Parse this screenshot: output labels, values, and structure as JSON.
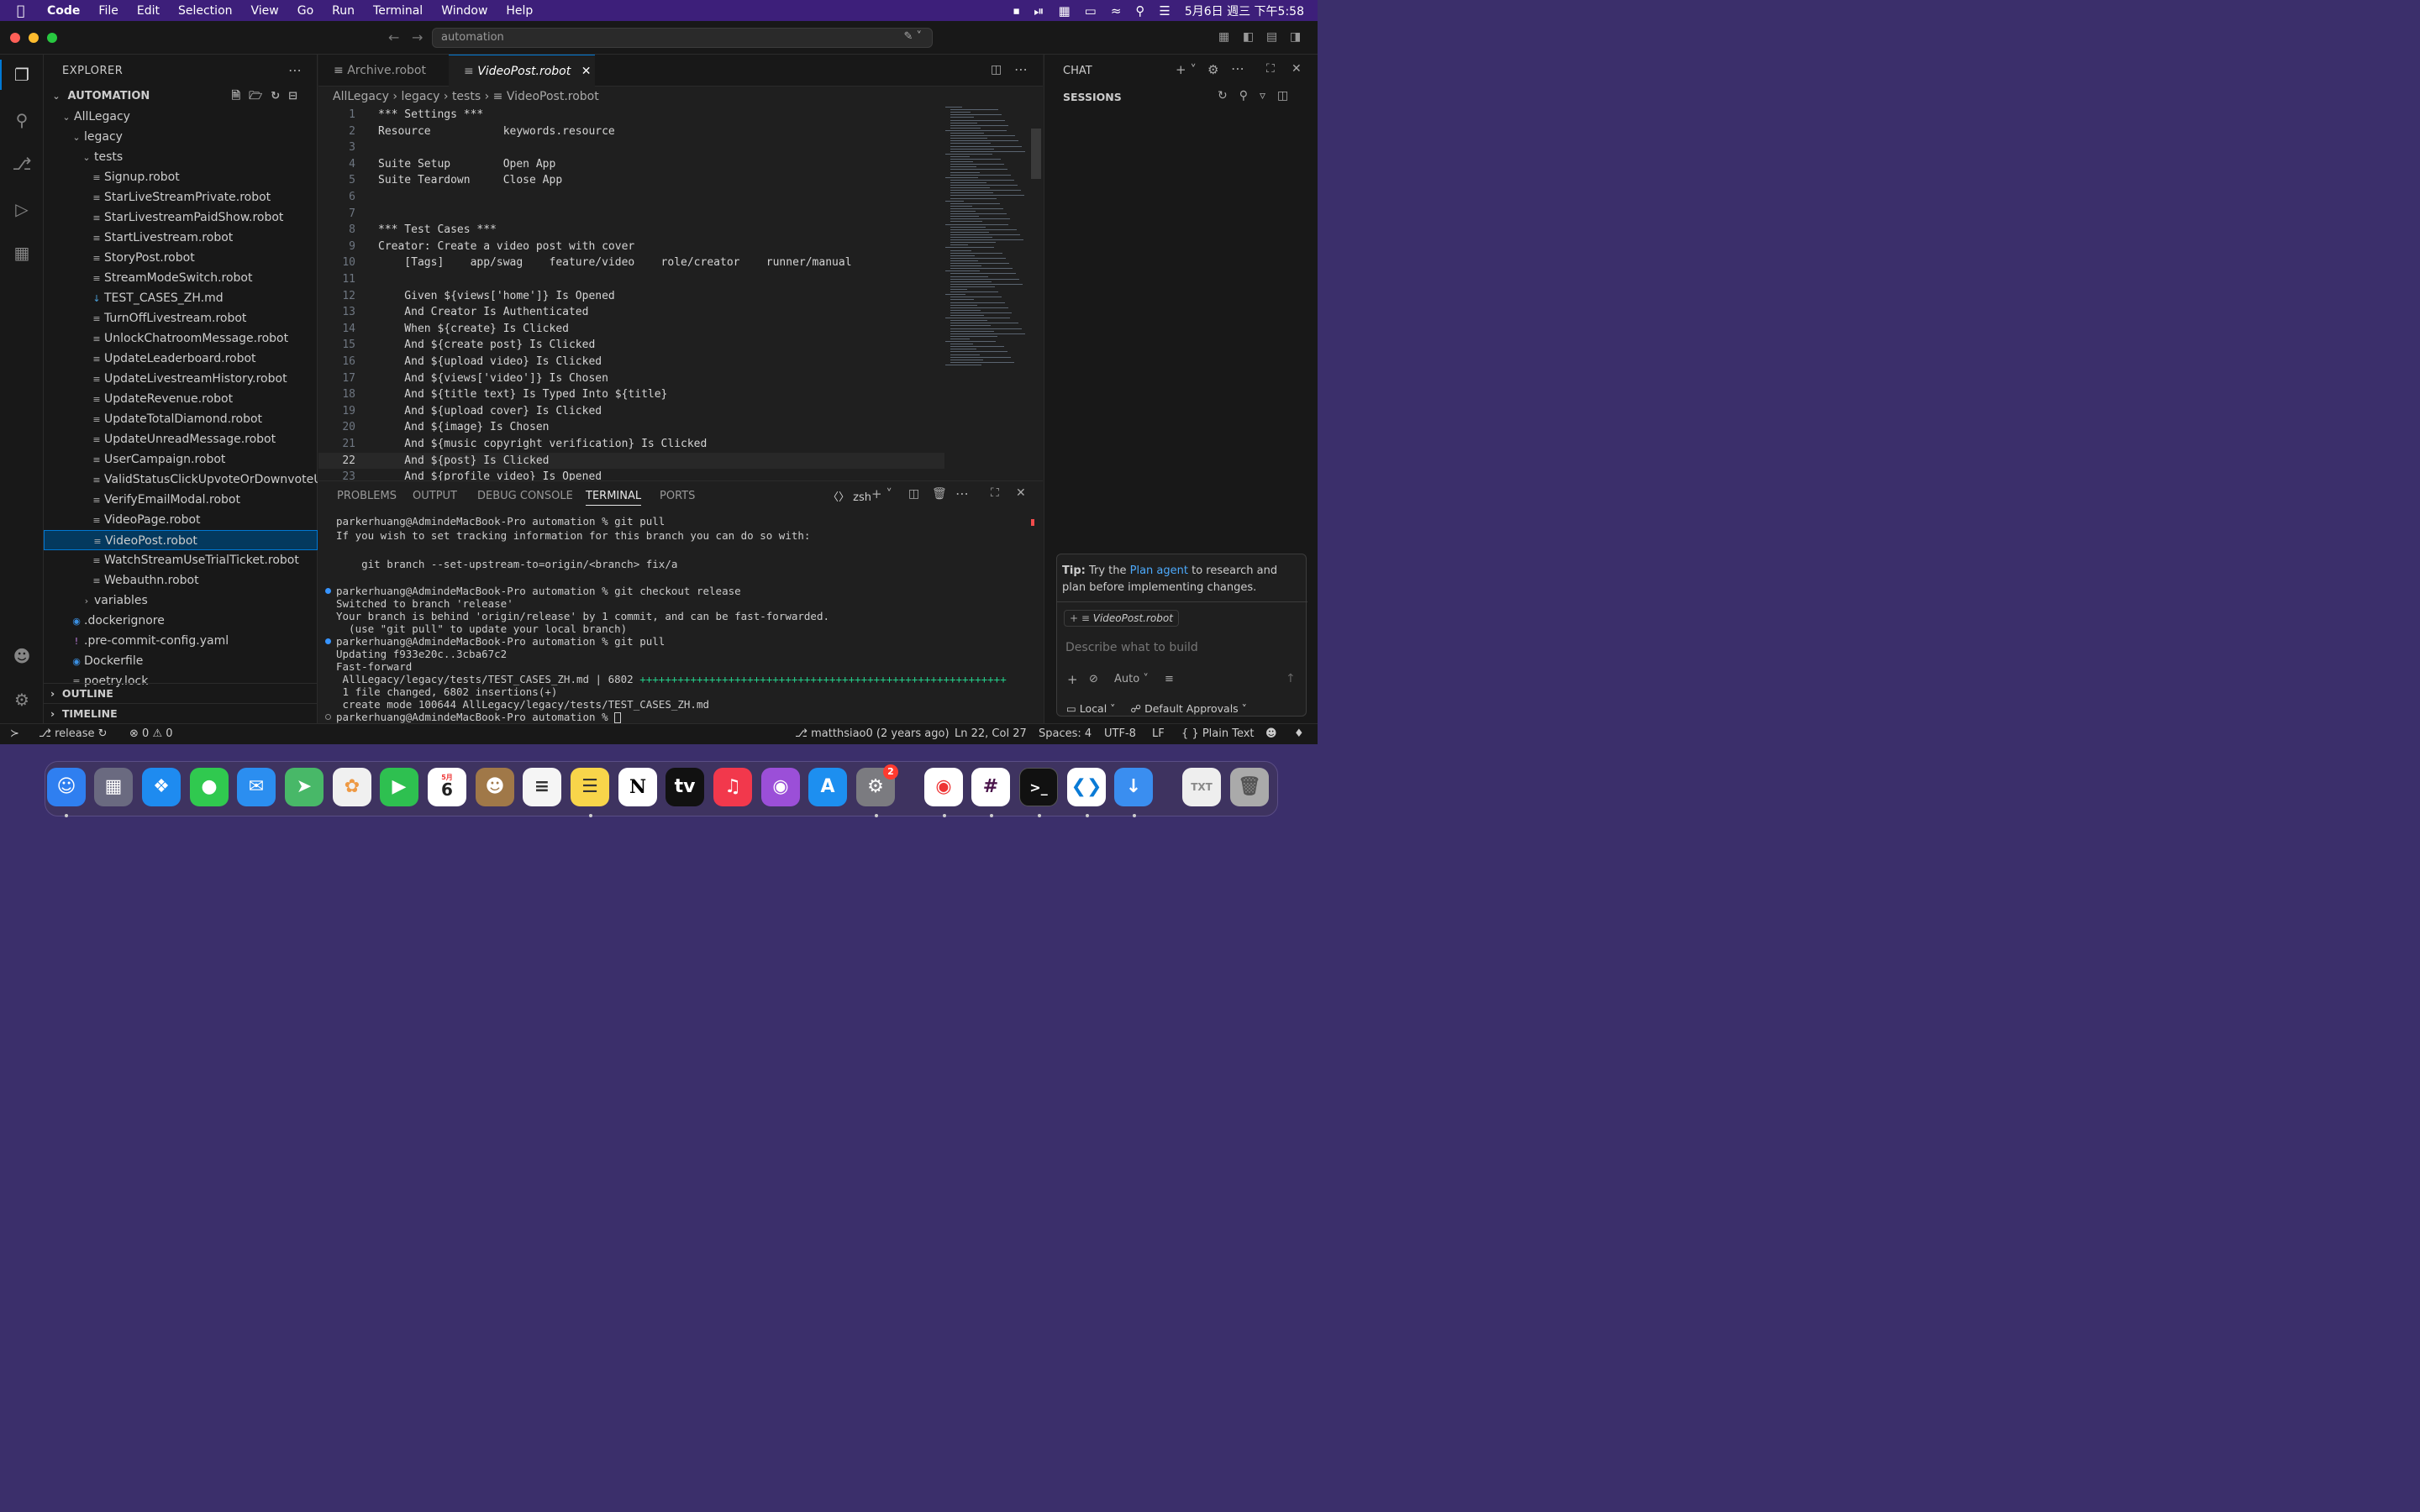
{
  "menubar": {
    "app": "Code",
    "items": [
      "File",
      "Edit",
      "Selection",
      "View",
      "Go",
      "Run",
      "Terminal",
      "Window",
      "Help"
    ],
    "clock": "5月6日 週三 下午5:58"
  },
  "titlebar": {
    "search": "automation"
  },
  "explorer": {
    "title": "EXPLORER",
    "workspace": "AUTOMATION",
    "tree": [
      {
        "label": "AllLegacy",
        "type": "folder-open",
        "depth": 1
      },
      {
        "label": "legacy",
        "type": "folder-open",
        "depth": 2
      },
      {
        "label": "tests",
        "type": "folder-open",
        "depth": 3
      },
      {
        "label": "Signup.robot",
        "type": "file",
        "depth": 4
      },
      {
        "label": "StarLiveStreamPrivate.robot",
        "type": "file",
        "depth": 4
      },
      {
        "label": "StarLivestreamPaidShow.robot",
        "type": "file",
        "depth": 4
      },
      {
        "label": "StartLivestream.robot",
        "type": "file",
        "depth": 4
      },
      {
        "label": "StoryPost.robot",
        "type": "file",
        "depth": 4
      },
      {
        "label": "StreamModeSwitch.robot",
        "type": "file",
        "depth": 4
      },
      {
        "label": "TEST_CASES_ZH.md",
        "type": "md",
        "depth": 4
      },
      {
        "label": "TurnOffLivestream.robot",
        "type": "file",
        "depth": 4
      },
      {
        "label": "UnlockChatroomMessage.robot",
        "type": "file",
        "depth": 4
      },
      {
        "label": "UpdateLeaderboard.robot",
        "type": "file",
        "depth": 4
      },
      {
        "label": "UpdateLivestreamHistory.robot",
        "type": "file",
        "depth": 4
      },
      {
        "label": "UpdateRevenue.robot",
        "type": "file",
        "depth": 4
      },
      {
        "label": "UpdateTotalDiamond.robot",
        "type": "file",
        "depth": 4
      },
      {
        "label": "UpdateUnreadMessage.robot",
        "type": "file",
        "depth": 4
      },
      {
        "label": "UserCampaign.robot",
        "type": "file",
        "depth": 4
      },
      {
        "label": "ValidStatusClickUpvoteOrDownvoteUp...",
        "type": "file",
        "depth": 4
      },
      {
        "label": "VerifyEmailModal.robot",
        "type": "file",
        "depth": 4
      },
      {
        "label": "VideoPage.robot",
        "type": "file",
        "depth": 4
      },
      {
        "label": "VideoPost.robot",
        "type": "file",
        "depth": 4,
        "selected": true
      },
      {
        "label": "WatchStreamUseTrialTicket.robot",
        "type": "file",
        "depth": 4
      },
      {
        "label": "Webauthn.robot",
        "type": "file",
        "depth": 4
      },
      {
        "label": "variables",
        "type": "folder",
        "depth": 3
      },
      {
        "label": ".dockerignore",
        "type": "docker",
        "depth": 2
      },
      {
        "label": ".pre-commit-config.yaml",
        "type": "yaml",
        "depth": 2
      },
      {
        "label": "Dockerfile",
        "type": "docker",
        "depth": 2
      },
      {
        "label": "poetry.lock",
        "type": "file",
        "depth": 2
      }
    ],
    "outline": "OUTLINE",
    "timeline": "TIMELINE"
  },
  "editor": {
    "tabs": [
      {
        "label": "Archive.robot"
      },
      {
        "label": "VideoPost.robot",
        "active": true
      }
    ],
    "breadcrumb": [
      "AllLegacy",
      "legacy",
      "tests",
      "VideoPost.robot"
    ],
    "lines": [
      "*** Settings ***",
      "Resource           keywords.resource",
      "",
      "Suite Setup        Open App",
      "Suite Teardown     Close App",
      "",
      "",
      "*** Test Cases ***",
      "Creator: Create a video post with cover",
      "    [Tags]    app/swag    feature/video    role/creator    runner/manual",
      "",
      "    Given ${views['home']} Is Opened",
      "    And Creator Is Authenticated",
      "    When ${create} Is Clicked",
      "    And ${create post} Is Clicked",
      "    And ${upload video} Is Clicked",
      "    And ${views['video']} Is Chosen",
      "    And ${title text} Is Typed Into ${title}",
      "    And ${upload cover} Is Clicked",
      "    And ${image} Is Chosen",
      "    And ${music copyright verification} Is Clicked",
      "    And ${post} Is Clicked",
      "    And ${profile video} Is Opened"
    ],
    "current_line": 22
  },
  "panel": {
    "tabs": [
      "PROBLEMS",
      "OUTPUT",
      "DEBUG CONSOLE",
      "TERMINAL",
      "PORTS"
    ],
    "active": "TERMINAL",
    "shell": "zsh",
    "terminal": [
      {
        "text": "parkerhuang@AdmindeMacBook-Pro automation % git pull",
        "dot": ""
      },
      {
        "text": "If you wish to set tracking information for this branch you can do so with:",
        "dot": ""
      },
      {
        "text": "",
        "dot": ""
      },
      {
        "text": "    git branch --set-upstream-to=origin/<branch> fix/a",
        "dot": ""
      },
      {
        "text": "",
        "dot": ""
      },
      {
        "text": "parkerhuang@AdmindeMacBook-Pro automation % git checkout release",
        "dot": "blue"
      },
      {
        "text": "Switched to branch 'release'",
        "dot": ""
      },
      {
        "text": "Your branch is behind 'origin/release' by 1 commit, and can be fast-forwarded.",
        "dot": ""
      },
      {
        "text": "  (use \"git pull\" to update your local branch)",
        "dot": ""
      },
      {
        "text": "parkerhuang@AdmindeMacBook-Pro automation % git pull",
        "dot": "blue"
      },
      {
        "text": "Updating f933e20c..3cba67c2",
        "dot": ""
      },
      {
        "text": "Fast-forward",
        "dot": ""
      },
      {
        "text": " AllLegacy/legacy/tests/TEST_CASES_ZH.md | 6802 ",
        "dot": "",
        "plus": "++++++++++++++++++++++++++++++++++++++++++++++++++++++++++"
      },
      {
        "text": " 1 file changed, 6802 insertions(+)",
        "dot": ""
      },
      {
        "text": " create mode 100644 AllLegacy/legacy/tests/TEST_CASES_ZH.md",
        "dot": ""
      },
      {
        "text": "parkerhuang@AdmindeMacBook-Pro automation % ",
        "dot": "hollow"
      }
    ]
  },
  "chat": {
    "title": "CHAT",
    "sessions": "SESSIONS",
    "tip_prefix": "Tip:",
    "tip_text1": " Try the ",
    "tip_link": "Plan agent",
    "tip_text2": " to research and plan before implementing changes.",
    "attachment": "VideoPost.robot",
    "placeholder": "Describe what to build",
    "mode": "Auto",
    "location": "Local",
    "approvals": "Default Approvals"
  },
  "status": {
    "branch": "release",
    "errors": "0",
    "warnings": "0",
    "blame": "matthsiao0 (2 years ago)",
    "position": "Ln 22, Col 27",
    "spaces": "Spaces: 4",
    "encoding": "UTF-8",
    "eol": "LF",
    "language": "Plain Text"
  },
  "dock": {
    "calendar_month": "5月",
    "calendar_day": "6",
    "settings_badge": "2"
  }
}
